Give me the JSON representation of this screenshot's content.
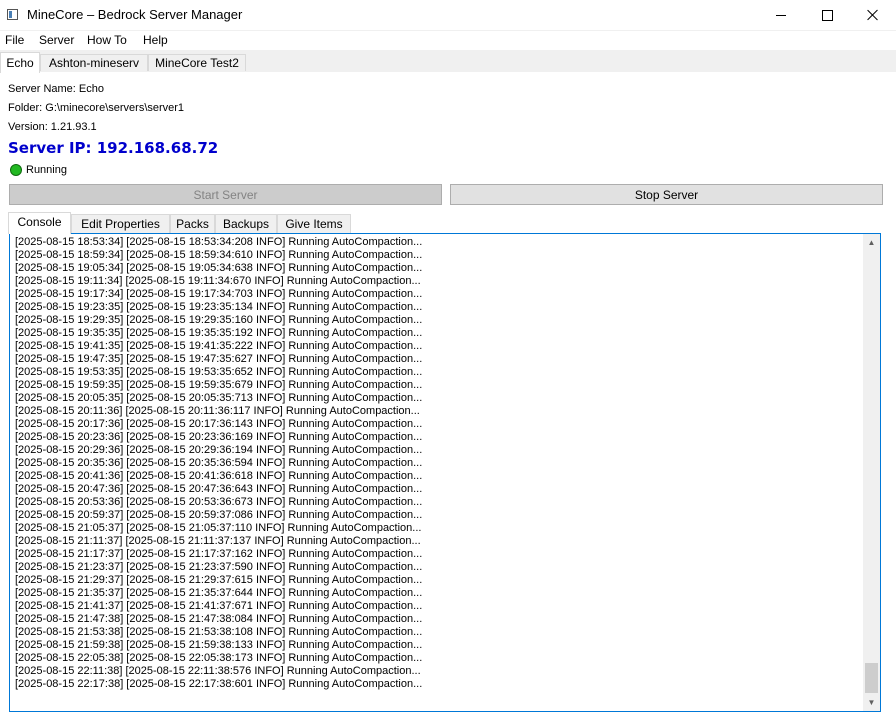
{
  "window": {
    "title": "MineCore – Bedrock Server Manager",
    "icon": "app-window-icon",
    "controls": {
      "minimize": "minimize-icon",
      "maximize": "maximize-icon",
      "close": "close-icon"
    }
  },
  "menu": [
    "File",
    "Server",
    "How To",
    "Help"
  ],
  "server_tabs": {
    "items": [
      "Echo",
      "Ashton-mineserv",
      "MineCore Test2"
    ],
    "active": "Echo"
  },
  "server_info": {
    "name_line": "Server Name: Echo",
    "folder_line": "Folder: G:\\minecore\\servers\\server1",
    "version_line": "Version: 1.21.93.1",
    "ip_line": "Server IP: 192.168.68.72",
    "status": "Running",
    "status_color": "#22b822",
    "ip_color": "#0000cc"
  },
  "actions": {
    "start": "Start Server",
    "start_enabled": false,
    "stop": "Stop Server",
    "stop_enabled": true
  },
  "sub_tabs": {
    "items": [
      "Console",
      "Edit Properties",
      "Packs",
      "Backups",
      "Give Items"
    ],
    "active": "Console"
  },
  "console": {
    "lines": [
      "[2025-08-15 18:53:34] [2025-08-15 18:53:34:208 INFO] Running AutoCompaction...",
      "[2025-08-15 18:59:34] [2025-08-15 18:59:34:610 INFO] Running AutoCompaction...",
      "[2025-08-15 19:05:34] [2025-08-15 19:05:34:638 INFO] Running AutoCompaction...",
      "[2025-08-15 19:11:34] [2025-08-15 19:11:34:670 INFO] Running AutoCompaction...",
      "[2025-08-15 19:17:34] [2025-08-15 19:17:34:703 INFO] Running AutoCompaction...",
      "[2025-08-15 19:23:35] [2025-08-15 19:23:35:134 INFO] Running AutoCompaction...",
      "[2025-08-15 19:29:35] [2025-08-15 19:29:35:160 INFO] Running AutoCompaction...",
      "[2025-08-15 19:35:35] [2025-08-15 19:35:35:192 INFO] Running AutoCompaction...",
      "[2025-08-15 19:41:35] [2025-08-15 19:41:35:222 INFO] Running AutoCompaction...",
      "[2025-08-15 19:47:35] [2025-08-15 19:47:35:627 INFO] Running AutoCompaction...",
      "[2025-08-15 19:53:35] [2025-08-15 19:53:35:652 INFO] Running AutoCompaction...",
      "[2025-08-15 19:59:35] [2025-08-15 19:59:35:679 INFO] Running AutoCompaction...",
      "[2025-08-15 20:05:35] [2025-08-15 20:05:35:713 INFO] Running AutoCompaction...",
      "[2025-08-15 20:11:36] [2025-08-15 20:11:36:117 INFO] Running AutoCompaction...",
      "[2025-08-15 20:17:36] [2025-08-15 20:17:36:143 INFO] Running AutoCompaction...",
      "[2025-08-15 20:23:36] [2025-08-15 20:23:36:169 INFO] Running AutoCompaction...",
      "[2025-08-15 20:29:36] [2025-08-15 20:29:36:194 INFO] Running AutoCompaction...",
      "[2025-08-15 20:35:36] [2025-08-15 20:35:36:594 INFO] Running AutoCompaction...",
      "[2025-08-15 20:41:36] [2025-08-15 20:41:36:618 INFO] Running AutoCompaction...",
      "[2025-08-15 20:47:36] [2025-08-15 20:47:36:643 INFO] Running AutoCompaction...",
      "[2025-08-15 20:53:36] [2025-08-15 20:53:36:673 INFO] Running AutoCompaction...",
      "[2025-08-15 20:59:37] [2025-08-15 20:59:37:086 INFO] Running AutoCompaction...",
      "[2025-08-15 21:05:37] [2025-08-15 21:05:37:110 INFO] Running AutoCompaction...",
      "[2025-08-15 21:11:37] [2025-08-15 21:11:37:137 INFO] Running AutoCompaction...",
      "[2025-08-15 21:17:37] [2025-08-15 21:17:37:162 INFO] Running AutoCompaction...",
      "[2025-08-15 21:23:37] [2025-08-15 21:23:37:590 INFO] Running AutoCompaction...",
      "[2025-08-15 21:29:37] [2025-08-15 21:29:37:615 INFO] Running AutoCompaction...",
      "[2025-08-15 21:35:37] [2025-08-15 21:35:37:644 INFO] Running AutoCompaction...",
      "[2025-08-15 21:41:37] [2025-08-15 21:41:37:671 INFO] Running AutoCompaction...",
      "[2025-08-15 21:47:38] [2025-08-15 21:47:38:084 INFO] Running AutoCompaction...",
      "[2025-08-15 21:53:38] [2025-08-15 21:53:38:108 INFO] Running AutoCompaction...",
      "[2025-08-15 21:59:38] [2025-08-15 21:59:38:133 INFO] Running AutoCompaction...",
      "[2025-08-15 22:05:38] [2025-08-15 22:05:38:173 INFO] Running AutoCompaction...",
      "[2025-08-15 22:11:38] [2025-08-15 22:11:38:576 INFO] Running AutoCompaction...",
      "[2025-08-15 22:17:38] [2025-08-15 22:17:38:601 INFO] Running AutoCompaction..."
    ],
    "scroll_up_icon": "scroll-up-arrow-icon",
    "scroll_down_icon": "scroll-down-arrow-icon"
  }
}
